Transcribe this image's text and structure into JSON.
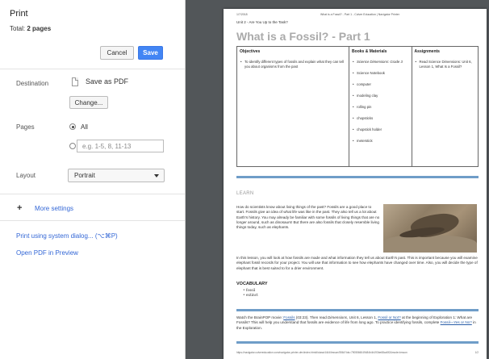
{
  "panel": {
    "title": "Print",
    "total_label": "Total: ",
    "total_value": "2 pages",
    "cancel_label": "Cancel",
    "save_label": "Save",
    "destination_label": "Destination",
    "destination_value": "Save as PDF",
    "change_label": "Change...",
    "pages_label": "Pages",
    "pages_all_label": "All",
    "pages_custom_placeholder": "e.g. 1-5, 8, 11-13",
    "layout_label": "Layout",
    "layout_value": "Portrait",
    "more_settings_label": "More settings",
    "system_dialog_label": "Print using system dialog... (⌥⌘P)",
    "open_pdf_label": "Open PDF in Preview"
  },
  "preview": {
    "header_date": "1/7/2018",
    "header_title": "What is a Fossil? - Part 1 - Culver Education | Navigator Printer",
    "unit_title": "Unit 2 - Are You Up to the Task?",
    "heading": "What is a Fossil? - Part 1",
    "objectives": {
      "header": "Objectives",
      "items": [
        "To identify different types of fossils and explain what they can tell you about organisms from the past"
      ]
    },
    "materials": {
      "header": "Books & Materials",
      "items": [
        "Science Dimensions: Grade 3",
        "Science Notebook",
        "computer",
        "modeling clay",
        "rolling pin",
        "chopsticks",
        "chopstick holder",
        "meterstick"
      ]
    },
    "assignments": {
      "header": "Assignments",
      "items": [
        "Read Science Dimensions: Unit 6, Lesson 1, What Is a Fossil?"
      ]
    },
    "learn_label": "LEARN",
    "para1": "How do scientists know about living things of the past? Fossils are a good place to start. Fossils give an idea of what life was like in the past. They also tell us a lot about Earth's history. You may already be familiar with some fossils of living things that are no longer around, such as dinosaurs! But there are also fossils that closely resemble living things today, such as elephants.",
    "para2": "In this lesson, you will look at how fossils are made and what information they tell us about Earth's past. This is important because you will examine elephant fossil records for your project. You will use that information to see how elephants have changed over time. Also, you will decide the type of elephant that is best suited to for a drier environment.",
    "vocab_header": "VOCABULARY",
    "vocab": [
      "fossil",
      "extinct"
    ],
    "para3_a": "Watch the BrainPOP movie: ",
    "para3_link1": "Fossils",
    "para3_b": " (03:23). Then read ",
    "para3_c": "Dimensions",
    "para3_d": ", Unit 6, Lesson 1, ",
    "para3_link2": "Fossil or Not?",
    "para3_e": " at the beginning of Exploration 1: What are Fossils? This will help you understand that fossils are evidence of life from long ago. To practice identifying fossils, complete ",
    "para3_link3": "Fossil—Yes or No?",
    "para3_f": " in the Exploration.",
    "footer_url": "https://navigator.culvereducation.com/navigator-printer-dev/index.html#/class/4444/lesson/5564?ids=7905566049484b4b193be68ca5f2&mode=lesson",
    "footer_page": "1/2"
  }
}
